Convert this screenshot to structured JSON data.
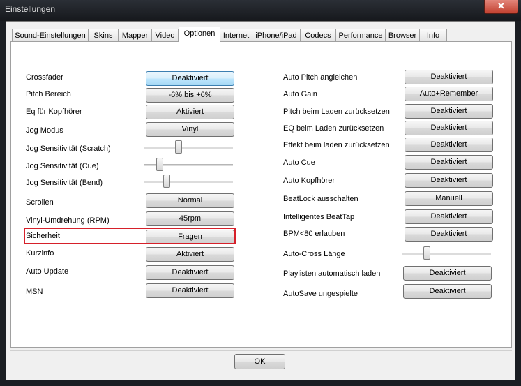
{
  "window": {
    "title": "Einstellungen",
    "close_label": "✕"
  },
  "tabs": [
    {
      "label": "Sound-Einstellungen"
    },
    {
      "label": "Skins"
    },
    {
      "label": "Mapper"
    },
    {
      "label": "Video"
    },
    {
      "label": "Optionen"
    },
    {
      "label": "Internet"
    },
    {
      "label": "iPhone/iPad"
    },
    {
      "label": "Codecs"
    },
    {
      "label": "Performance"
    },
    {
      "label": "Browser"
    },
    {
      "label": "Info"
    }
  ],
  "active_tab": "Optionen",
  "left": [
    {
      "label": "Crossfader",
      "value": "Deaktiviert"
    },
    {
      "label": "Pitch Bereich",
      "value": "-6% bis +6%"
    },
    {
      "label": "Eq für Kopfhörer",
      "value": "Aktiviert"
    },
    {
      "label": "Jog Modus",
      "value": "Vinyl"
    },
    {
      "label": "Jog Sensitivität (Scratch)"
    },
    {
      "label": "Jog Sensitivität (Cue)"
    },
    {
      "label": "Jog Sensitivität (Bend)"
    },
    {
      "label": "Scrollen",
      "value": "Normal"
    },
    {
      "label": "Vinyl-Umdrehung (RPM)",
      "value": "45rpm"
    },
    {
      "label": "Sicherheit",
      "value": "Fragen"
    },
    {
      "label": "Kurzinfo",
      "value": "Aktiviert"
    },
    {
      "label": "Auto Update",
      "value": "Deaktiviert"
    },
    {
      "label": "MSN",
      "value": "Deaktiviert"
    }
  ],
  "right": [
    {
      "label": "Auto Pitch angleichen",
      "value": "Deaktiviert"
    },
    {
      "label": "Auto Gain",
      "value": "Auto+Remember"
    },
    {
      "label": "Pitch beim Laden zurücksetzen",
      "value": "Deaktiviert"
    },
    {
      "label": "EQ beim Laden zurücksetzen",
      "value": "Deaktiviert"
    },
    {
      "label": "Effekt beim laden zurücksetzen",
      "value": "Deaktiviert"
    },
    {
      "label": "Auto Cue",
      "value": "Deaktiviert"
    },
    {
      "label": "Auto Kopfhörer",
      "value": "Deaktiviert"
    },
    {
      "label": "BeatLock ausschalten",
      "value": "Manuell"
    },
    {
      "label": "Intelligentes BeatTap",
      "value": "Deaktiviert"
    },
    {
      "label": "BPM<80 erlauben",
      "value": "Deaktiviert"
    },
    {
      "label": "Auto-Cross Länge"
    },
    {
      "label": "Playlisten automatisch laden",
      "value": "Deaktiviert"
    },
    {
      "label": "AutoSave ungespielte",
      "value": "Deaktiviert"
    }
  ],
  "sliders": {
    "jog_scratch": 0.38,
    "jog_cue": 0.15,
    "jog_bend": 0.24,
    "auto_cross": 0.26
  },
  "ok_label": "OK"
}
